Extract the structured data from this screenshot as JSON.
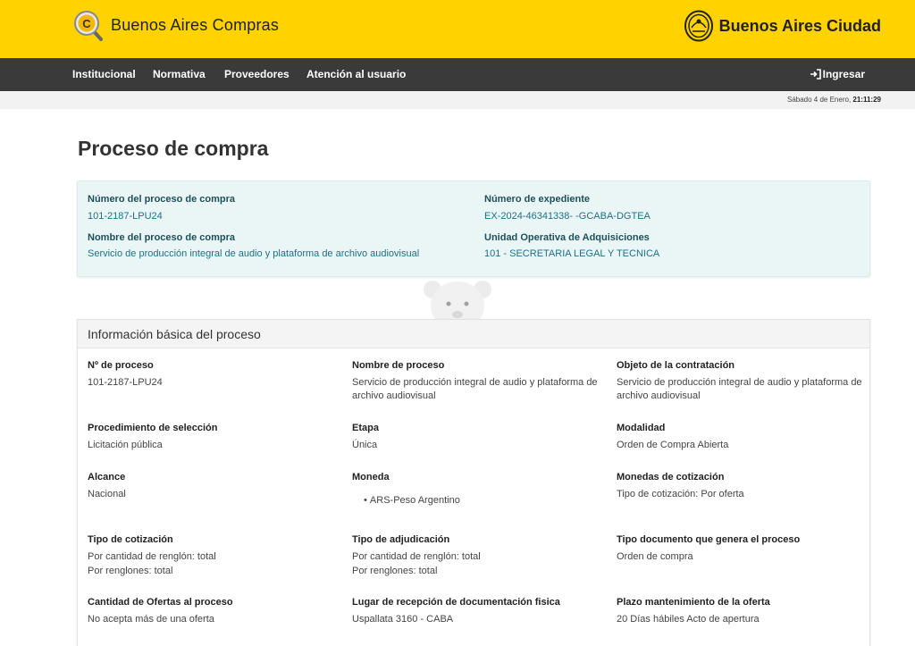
{
  "header": {
    "left_brand": "Buenos Aires Compras",
    "right_brand": "Buenos Aires Ciudad",
    "accent_color": "#ffd200"
  },
  "nav": {
    "items": [
      "Institucional",
      "Normativa",
      "Proveedores",
      "Atención al usuario"
    ],
    "login": "Ingresar"
  },
  "datebar": {
    "date": "Sábado 4 de Enero,",
    "time": "21:11:29"
  },
  "page": {
    "title": "Proceso de compra"
  },
  "summary": {
    "numero_label": "Número del proceso de compra",
    "numero_value": "101-2187-LPU24",
    "nombre_label": "Nombre del proceso de compra",
    "nombre_value": "Servicio de producción integral de audio y plataforma de archivo audiovisual",
    "expediente_label": "Número de expediente",
    "expediente_value": "EX-2024-46341338- -GCABA-DGTEA",
    "unidad_label": "Unidad Operativa de Adquisiciones",
    "unidad_value": "101 - SECRETARIA LEGAL Y TECNICA"
  },
  "info": {
    "title": "Información básica del proceso",
    "fields": {
      "nro_proceso": {
        "label": "Nº de proceso",
        "value": "101-2187-LPU24"
      },
      "nombre_proceso": {
        "label": "Nombre de proceso",
        "value": "Servicio de producción integral de audio y plataforma de archivo audiovisual"
      },
      "objeto": {
        "label": "Objeto de la contratación",
        "value": "Servicio de producción integral de audio y plataforma de archivo audiovisual"
      },
      "procedimiento": {
        "label": "Procedimiento de selección",
        "value": "Licitación pública"
      },
      "etapa": {
        "label": "Etapa",
        "value": "Única"
      },
      "modalidad": {
        "label": "Modalidad",
        "value": "Orden de Compra Abierta"
      },
      "alcance": {
        "label": "Alcance",
        "value": "Nacional"
      },
      "moneda": {
        "label": "Moneda",
        "value": "ARS-Peso Argentino"
      },
      "monedas_cotizacion": {
        "label": "Monedas de cotización",
        "value": "Tipo de cotización: Por oferta"
      },
      "tipo_cotizacion": {
        "label": "Tipo de cotización",
        "line1": "Por cantidad de renglón: total",
        "line2": "Por renglones: total"
      },
      "tipo_adjudicacion": {
        "label": "Tipo de adjudicación",
        "line1": "Por cantidad de renglón: total",
        "line2": "Por renglones: total"
      },
      "tipo_documento": {
        "label": "Tipo documento que genera el proceso",
        "value": "Orden de compra"
      },
      "cantidad_ofertas": {
        "label": "Cantidad de Ofertas al proceso",
        "value": "No acepta más de una oferta"
      },
      "lugar_recepcion": {
        "label": "Lugar de recepción de documentación fisica",
        "value": "Uspallata 3160 - CABA"
      },
      "plazo": {
        "label": "Plazo mantenimiento de la oferta",
        "value": "20 Días hábiles Acto de apertura"
      }
    }
  }
}
